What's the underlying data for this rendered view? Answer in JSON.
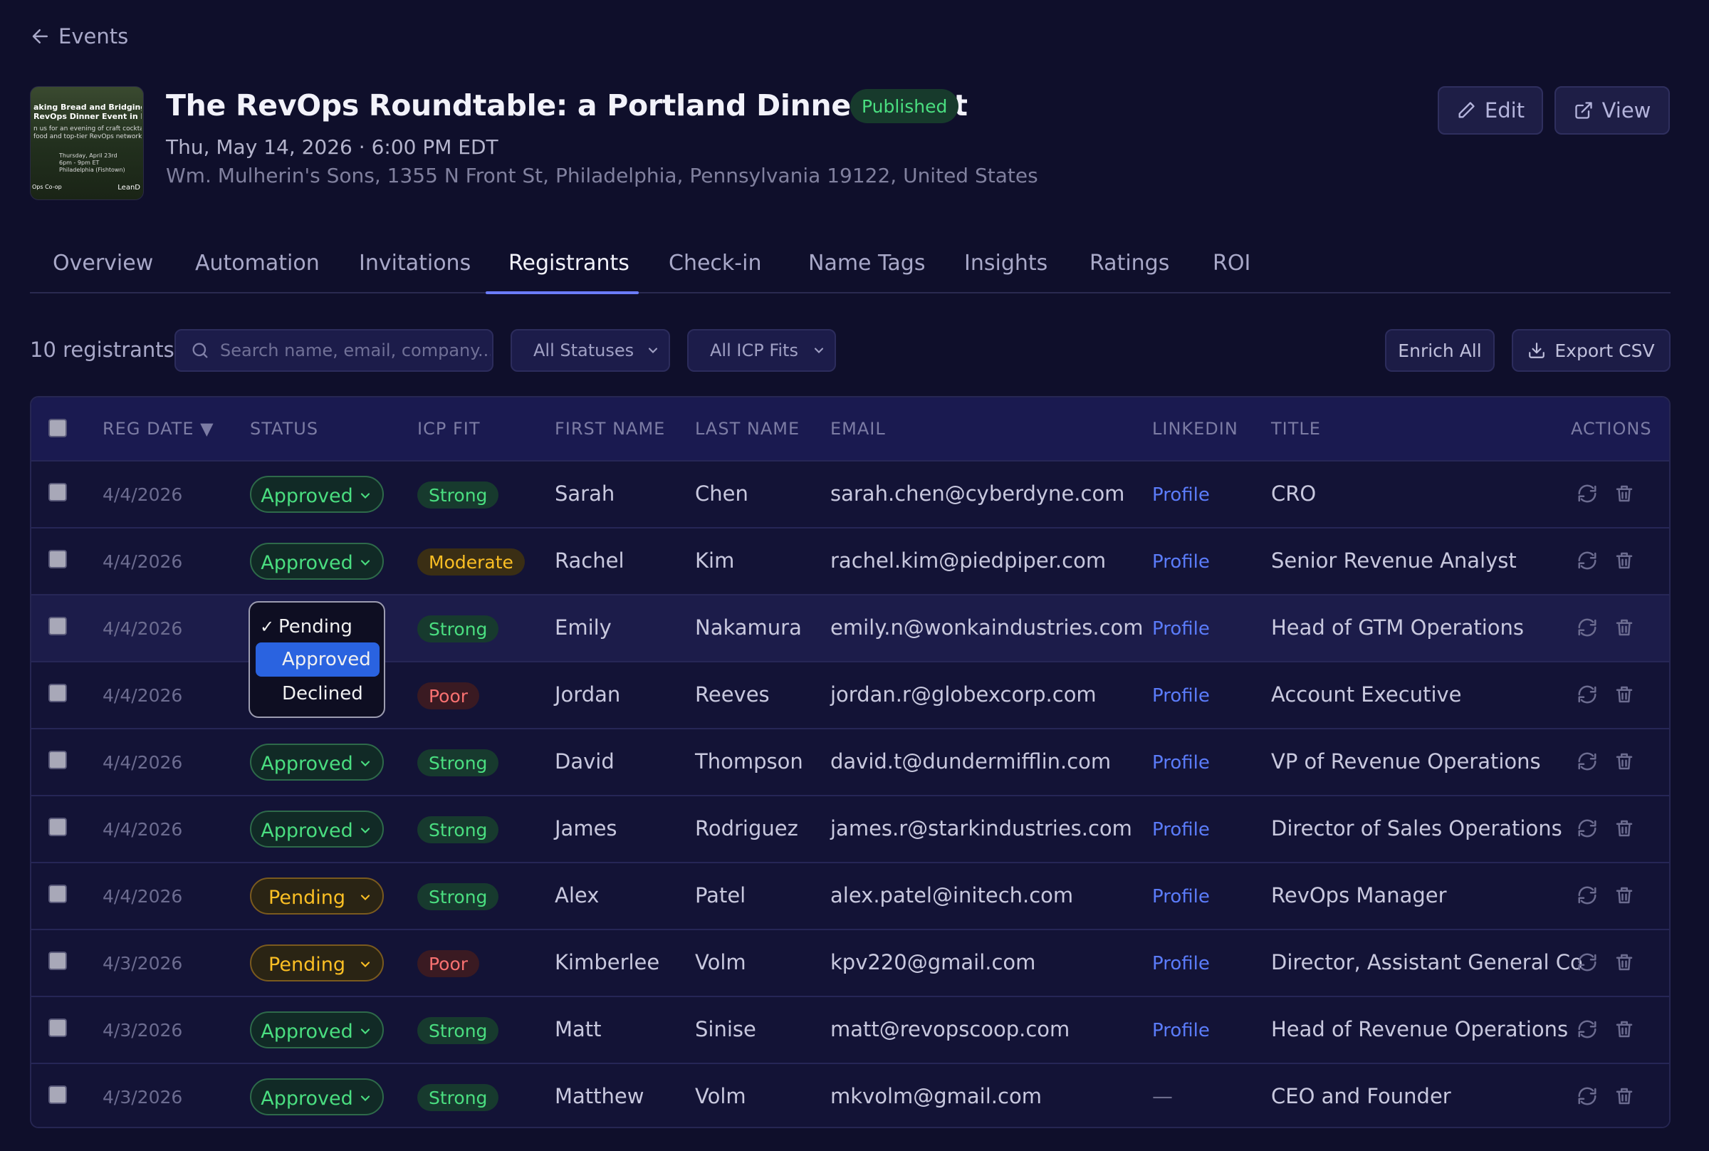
{
  "nav": {
    "back_label": "Events"
  },
  "event": {
    "title": "The RevOps Roundtable: a Portland Dinner Event",
    "status": "Published",
    "datetime": "Thu, May 14, 2026 · 6:00 PM EDT",
    "address": "Wm. Mulherin's Sons, 1355 N Front St, Philadelphia, Pennsylvania 19122, United States",
    "thumbnail": {
      "line1": "aking Bread and Bridging Gap",
      "line2": "RevOps Dinner Event in Phil",
      "line3": "n us for an evening of craft cocktails,",
      "line4": "food and top-tier RevOps networking",
      "line5": "Thursday, April 23rd",
      "line6": "6pm - 9pm ET",
      "line7": "Philadelphia (Fishtown)",
      "corner_left": "Ops Co-op",
      "corner_right": "LeanD"
    }
  },
  "header_buttons": {
    "edit": "Edit",
    "view": "View"
  },
  "tabs": [
    {
      "label": "Overview"
    },
    {
      "label": "Automation"
    },
    {
      "label": "Invitations"
    },
    {
      "label": "Registrants"
    },
    {
      "label": "Check-in"
    },
    {
      "label": "Name Tags"
    },
    {
      "label": "Insights"
    },
    {
      "label": "Ratings"
    },
    {
      "label": "ROI"
    }
  ],
  "active_tab": "Registrants",
  "toolbar": {
    "count_label": "10 registrants",
    "search_placeholder": "Search name, email, company...",
    "status_filter": "All Statuses",
    "icp_filter": "All ICP Fits",
    "enrich_label": "Enrich All",
    "export_label": "Export CSV"
  },
  "columns": {
    "reg_date": "REG DATE ▼",
    "status": "STATUS",
    "icp_fit": "ICP FIT",
    "first_name": "FIRST NAME",
    "last_name": "LAST NAME",
    "email": "EMAIL",
    "linkedin": "LINKEDIN",
    "title": "TITLE",
    "actions": "ACTIONS"
  },
  "rows": [
    {
      "date": "4/4/2026",
      "status": "Approved",
      "icp": "Strong",
      "first": "Sarah",
      "last": "Chen",
      "email": "sarah.chen@cyberdyne.com",
      "linkedin": "Profile",
      "title": "CRO"
    },
    {
      "date": "4/4/2026",
      "status": "Approved",
      "icp": "Moderate",
      "first": "Rachel",
      "last": "Kim",
      "email": "rachel.kim@piedpiper.com",
      "linkedin": "Profile",
      "title": "Senior Revenue Analyst"
    },
    {
      "date": "4/4/2026",
      "status": "Approved",
      "icp": "Strong",
      "first": "Emily",
      "last": "Nakamura",
      "email": "emily.n@wonkaindustries.com",
      "linkedin": "Profile",
      "title": "Head of GTM Operations"
    },
    {
      "date": "4/4/2026",
      "status": "Declined",
      "icp": "Poor",
      "first": "Jordan",
      "last": "Reeves",
      "email": "jordan.r@globexcorp.com",
      "linkedin": "Profile",
      "title": "Account Executive"
    },
    {
      "date": "4/4/2026",
      "status": "Approved",
      "icp": "Strong",
      "first": "David",
      "last": "Thompson",
      "email": "david.t@dundermifflin.com",
      "linkedin": "Profile",
      "title": "VP of Revenue Operations"
    },
    {
      "date": "4/4/2026",
      "status": "Approved",
      "icp": "Strong",
      "first": "James",
      "last": "Rodriguez",
      "email": "james.r@starkindustries.com",
      "linkedin": "Profile",
      "title": "Director of Sales Operations"
    },
    {
      "date": "4/4/2026",
      "status": "Pending",
      "icp": "Strong",
      "first": "Alex",
      "last": "Patel",
      "email": "alex.patel@initech.com",
      "linkedin": "Profile",
      "title": "RevOps Manager"
    },
    {
      "date": "4/3/2026",
      "status": "Pending",
      "icp": "Poor",
      "first": "Kimberlee",
      "last": "Volm",
      "email": "kpv220@gmail.com",
      "linkedin": "Profile",
      "title": "Director, Assistant General Co"
    },
    {
      "date": "4/3/2026",
      "status": "Approved",
      "icp": "Strong",
      "first": "Matt",
      "last": "Sinise",
      "email": "matt@revopscoop.com",
      "linkedin": "Profile",
      "title": "Head of Revenue Operations"
    },
    {
      "date": "4/3/2026",
      "status": "Approved",
      "icp": "Strong",
      "first": "Matthew",
      "last": "Volm",
      "email": "mkvolm@gmail.com",
      "linkedin": "—",
      "title": "CEO and Founder"
    }
  ],
  "status_dropdown": {
    "options": [
      {
        "label": "Pending",
        "checked": true
      },
      {
        "label": "Approved",
        "highlighted": true
      },
      {
        "label": "Declined"
      }
    ],
    "check_mark": "✓"
  },
  "colors": {
    "background": "#0f0f2b",
    "accent": "#6b7cff",
    "approved": "#4ade80",
    "pending": "#fbbf24",
    "poor": "#f87171",
    "link": "#5b7cfa",
    "dropdown_highlight": "#2a63e0"
  },
  "icons": {
    "back": "arrow-left-icon",
    "edit": "pencil-icon",
    "view": "external-link-icon",
    "search": "search-icon",
    "export": "download-icon",
    "refresh": "refresh-icon",
    "delete": "trash-icon"
  }
}
